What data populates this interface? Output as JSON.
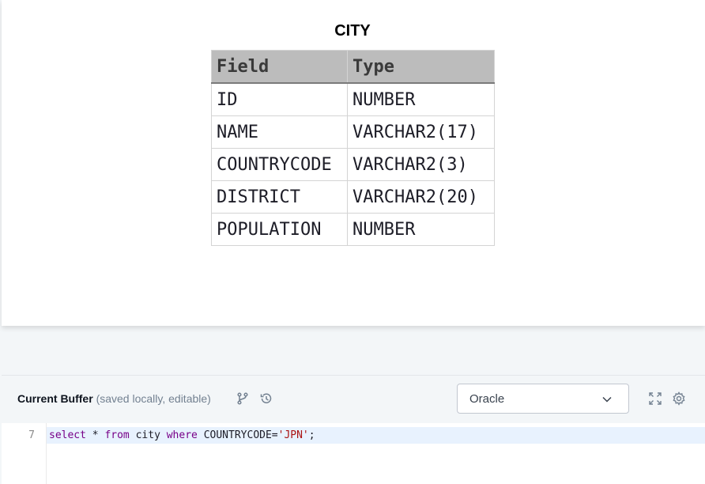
{
  "schema_view": {
    "table_name": "CITY",
    "columns_header": [
      "Field",
      "Type"
    ],
    "rows": [
      {
        "field": "ID",
        "type": "NUMBER"
      },
      {
        "field": "NAME",
        "type": "VARCHAR2(17)"
      },
      {
        "field": "COUNTRYCODE",
        "type": "VARCHAR2(3)"
      },
      {
        "field": "DISTRICT",
        "type": "VARCHAR2(20)"
      },
      {
        "field": "POPULATION",
        "type": "NUMBER"
      }
    ]
  },
  "editor": {
    "buffer_label": "Current Buffer",
    "buffer_sub": "(saved locally, editable)",
    "language": "Oracle",
    "icons": [
      "branch-icon",
      "history-icon",
      "expand-icon",
      "settings-icon"
    ],
    "line_number": "7",
    "code_tokens": [
      {
        "text": "select",
        "cls": "kw"
      },
      {
        "text": " * ",
        "cls": ""
      },
      {
        "text": "from",
        "cls": "kw"
      },
      {
        "text": " city ",
        "cls": ""
      },
      {
        "text": "where",
        "cls": "kw"
      },
      {
        "text": " COUNTRYCODE=",
        "cls": ""
      },
      {
        "text": "'JPN'",
        "cls": "str"
      },
      {
        "text": ";",
        "cls": ""
      }
    ]
  },
  "colors": {
    "keyword": "#770088",
    "string": "#aa1111",
    "active_line": "#e8f2fe"
  }
}
